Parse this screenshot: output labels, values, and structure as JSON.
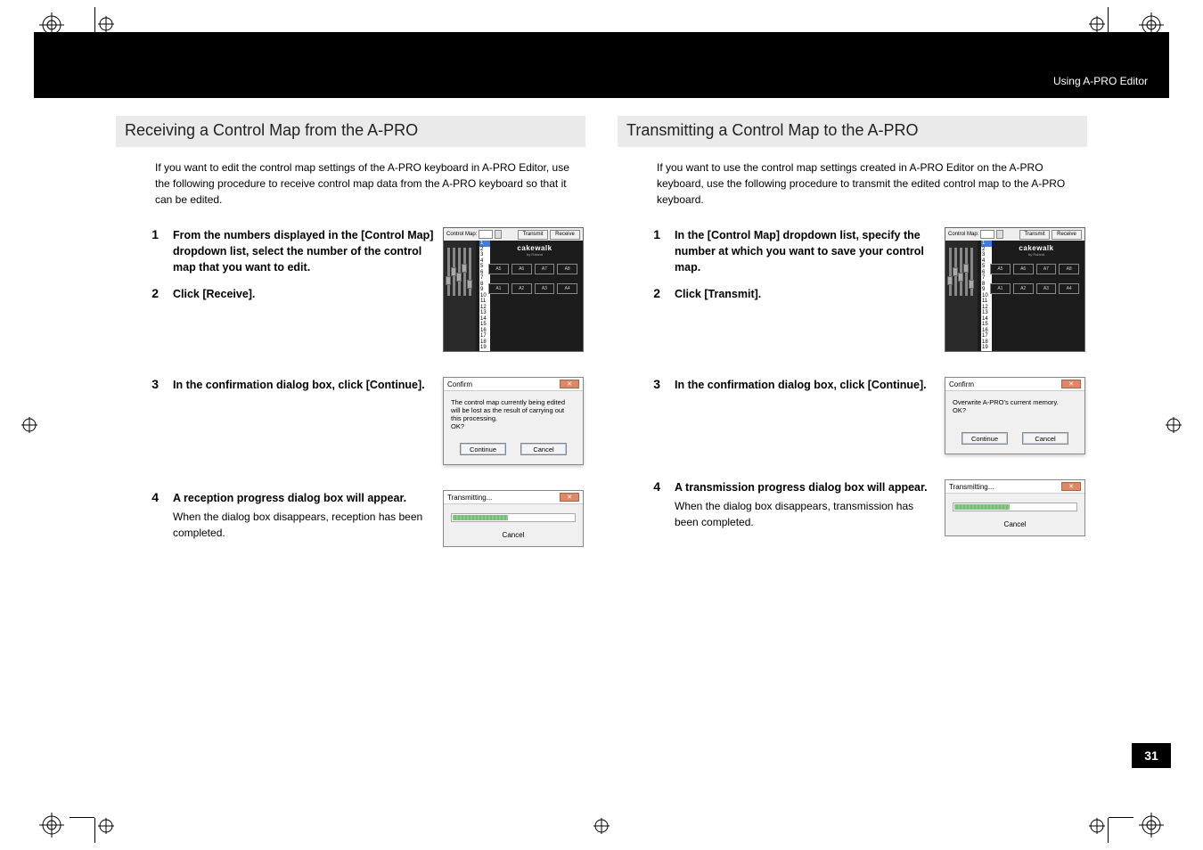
{
  "header": {
    "breadcrumb": "Using A-PRO Editor"
  },
  "page_number": "31",
  "left": {
    "title": "Receiving a Control Map from the A-PRO",
    "intro": "If you want to edit the control map settings of the A-PRO keyboard in A-PRO Editor, use the following procedure to receive control map data from the A-PRO keyboard so that it can be edited.",
    "steps": {
      "s1_num": "1",
      "s1": "From the numbers displayed in the [Control Map] dropdown list, select the number of the control map that you want to edit.",
      "s2_num": "2",
      "s2": "Click [Receive].",
      "s3_num": "3",
      "s3": "In the confirmation dialog box, click [Continue].",
      "s4_num": "4",
      "s4": "A reception progress dialog box will appear.",
      "s4_sub": "When the dialog box disappears, reception has been completed."
    }
  },
  "right": {
    "title": "Transmitting a Control Map to the A-PRO",
    "intro": "If you want to use the control map settings created in A-PRO Editor on the A-PRO keyboard, use the following procedure to transmit the edited control map to the A-PRO keyboard.",
    "steps": {
      "s1_num": "1",
      "s1": "In the [Control Map] dropdown list, specify the number at which you want to save your control map.",
      "s2_num": "2",
      "s2": "Click [Transmit].",
      "s3_num": "3",
      "s3": "In the confirmation dialog box, click [Continue].",
      "s4_num": "4",
      "s4": "A transmission progress dialog box will appear.",
      "s4_sub": "When the dialog box disappears, transmission has been completed."
    }
  },
  "editor": {
    "label": "Control Map:",
    "transmit": "Transmit",
    "receive": "Receive",
    "brand": "cakewalk",
    "sub": "by Roland",
    "options": [
      "1",
      "2",
      "3",
      "4",
      "5",
      "6",
      "7",
      "8",
      "9",
      "10",
      "11",
      "12",
      "13",
      "14",
      "15",
      "16",
      "17",
      "18",
      "19"
    ],
    "abtns_row1": [
      "A5",
      "A6",
      "A7",
      "A8"
    ],
    "abtns_row2": [
      "A1",
      "A2",
      "A3",
      "A4"
    ]
  },
  "confirm_rx": {
    "title": "Confirm",
    "msg": "The control map currently being edited will be lost as the result of carrying out this processing.\nOK?",
    "continue": "Continue",
    "cancel": "Cancel"
  },
  "confirm_tx": {
    "title": "Confirm",
    "msg": "Overwrite A-PRO's current memory.\nOK?",
    "continue": "Continue",
    "cancel": "Cancel"
  },
  "progress": {
    "title": "Transmitting...",
    "cancel": "Cancel"
  }
}
